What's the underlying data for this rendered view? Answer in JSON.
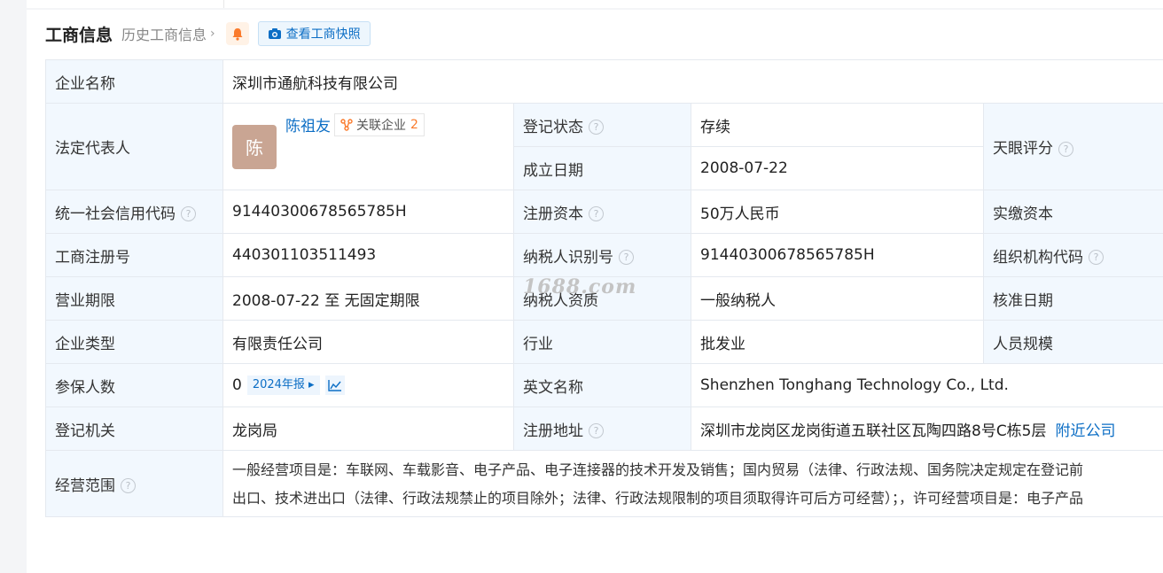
{
  "header": {
    "title": "工商信息",
    "history_link": "历史工商信息",
    "bell_icon": "bell-icon",
    "snapshot_button": "查看工商快照",
    "camera_icon": "camera-icon"
  },
  "rows": {
    "company_name_label": "企业名称",
    "company_name": "深圳市通航科技有限公司",
    "legal_rep_label": "法定代表人",
    "legal_rep_avatar": "陈",
    "legal_rep_name": "陈祖友",
    "related_label": "关联企业",
    "related_count": "2",
    "reg_status_label": "登记状态",
    "reg_status": "存续",
    "established_label": "成立日期",
    "established": "2008-07-22",
    "rating_label": "天眼评分",
    "credit_code_label": "统一社会信用代码",
    "credit_code": "91440300678565785H",
    "reg_capital_label": "注册资本",
    "reg_capital": "50万人民币",
    "paid_capital_label": "实缴资本",
    "biz_reg_no_label": "工商注册号",
    "biz_reg_no": "440301103511493",
    "taxpayer_id_label": "纳税人识别号",
    "taxpayer_id": "91440300678565785H",
    "org_code_label": "组织机构代码",
    "term_label": "营业期限",
    "term": "2008-07-22 至 无固定期限",
    "taxpayer_qual_label": "纳税人资质",
    "taxpayer_qual": "一般纳税人",
    "approval_date_label": "核准日期",
    "company_type_label": "企业类型",
    "company_type": "有限责任公司",
    "industry_label": "行业",
    "industry": "批发业",
    "staff_size_label": "人员规模",
    "insured_label": "参保人数",
    "insured": "0",
    "insured_report": "2024年报",
    "english_name_label": "英文名称",
    "english_name": "Shenzhen Tonghang Technology Co., Ltd.",
    "authority_label": "登记机关",
    "authority": "龙岗局",
    "address_label": "注册地址",
    "address": "深圳市龙岗区龙岗街道五联社区瓦陶四路8号C栋5层",
    "nearby_link": "附近公司",
    "scope_label": "经营范围",
    "scope_line1": "一般经营项目是：车联网、车载影音、电子产品、电子连接器的技术开发及销售；国内贸易（法律、行政法规、国务院决定规定在登记前",
    "scope_line2": "出口、技术进出口（法律、行政法规禁止的项目除外；法律、行政法规限制的项目须取得许可后方可经营）；，许可经营项目是：电子产品"
  },
  "watermark": "1688.com",
  "colors": {
    "label_bg": "#f2f8fe",
    "link": "#0c6ec5",
    "status_green": "#1d9d5f",
    "avatar_bg": "#c9a593",
    "count_orange": "#fa7a2b"
  }
}
